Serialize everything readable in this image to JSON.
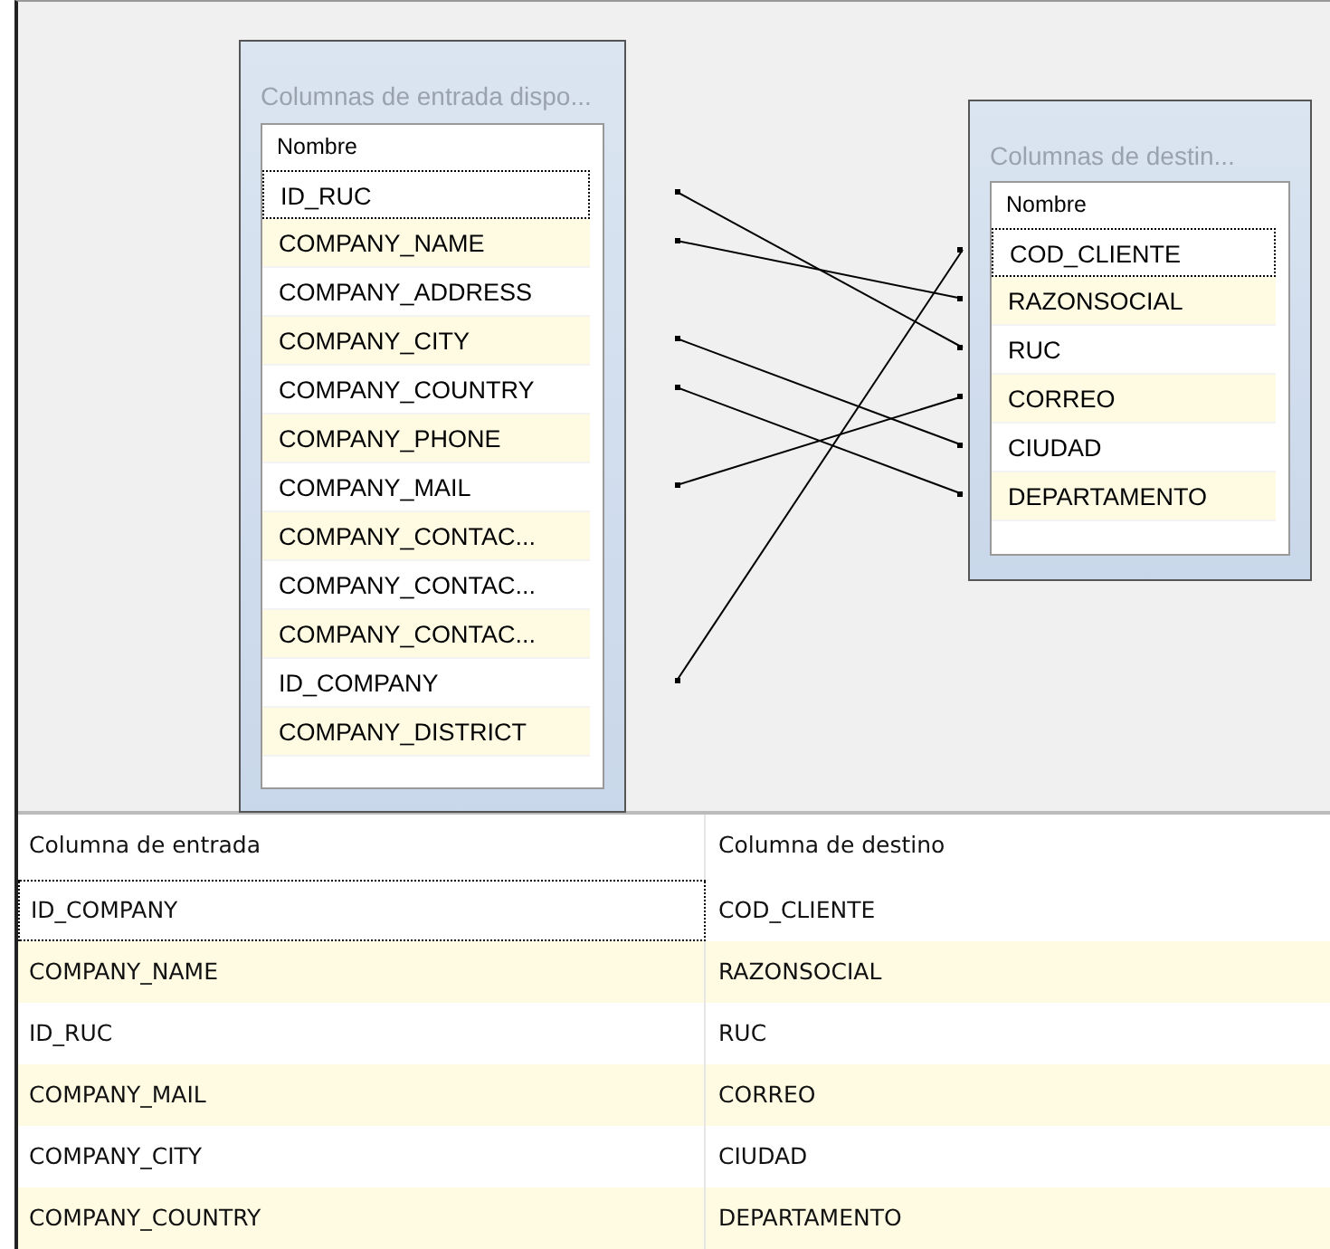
{
  "input_box": {
    "title": "Columnas de entrada dispo...",
    "header": "Nombre",
    "items": [
      {
        "label": "ID_RUC",
        "selected": true
      },
      {
        "label": "COMPANY_NAME",
        "selected": false
      },
      {
        "label": "COMPANY_ADDRESS",
        "selected": false
      },
      {
        "label": "COMPANY_CITY",
        "selected": false
      },
      {
        "label": "COMPANY_COUNTRY",
        "selected": false
      },
      {
        "label": "COMPANY_PHONE",
        "selected": false
      },
      {
        "label": "COMPANY_MAIL",
        "selected": false
      },
      {
        "label": "COMPANY_CONTAC...",
        "selected": false
      },
      {
        "label": "COMPANY_CONTAC...",
        "selected": false
      },
      {
        "label": "COMPANY_CONTAC...",
        "selected": false
      },
      {
        "label": "ID_COMPANY",
        "selected": false
      },
      {
        "label": "COMPANY_DISTRICT",
        "selected": false
      }
    ]
  },
  "output_box": {
    "title": "Columnas de destin...",
    "header": "Nombre",
    "items": [
      {
        "label": "COD_CLIENTE",
        "selected": true
      },
      {
        "label": "RAZONSOCIAL",
        "selected": false
      },
      {
        "label": "RUC",
        "selected": false
      },
      {
        "label": "CORREO",
        "selected": false
      },
      {
        "label": "CIUDAD",
        "selected": false
      },
      {
        "label": "DEPARTAMENTO",
        "selected": false
      }
    ]
  },
  "table": {
    "columns": [
      "Columna de entrada",
      "Columna de destino"
    ],
    "rows": [
      {
        "cells": [
          "ID_COMPANY",
          "COD_CLIENTE"
        ],
        "selected": true
      },
      {
        "cells": [
          "COMPANY_NAME",
          "RAZONSOCIAL"
        ],
        "selected": false
      },
      {
        "cells": [
          "ID_RUC",
          "RUC"
        ],
        "selected": false
      },
      {
        "cells": [
          "COMPANY_MAIL",
          "CORREO"
        ],
        "selected": false
      },
      {
        "cells": [
          "COMPANY_CITY",
          "CIUDAD"
        ],
        "selected": false
      },
      {
        "cells": [
          "COMPANY_COUNTRY",
          "DEPARTAMENTO"
        ],
        "selected": false
      }
    ]
  }
}
